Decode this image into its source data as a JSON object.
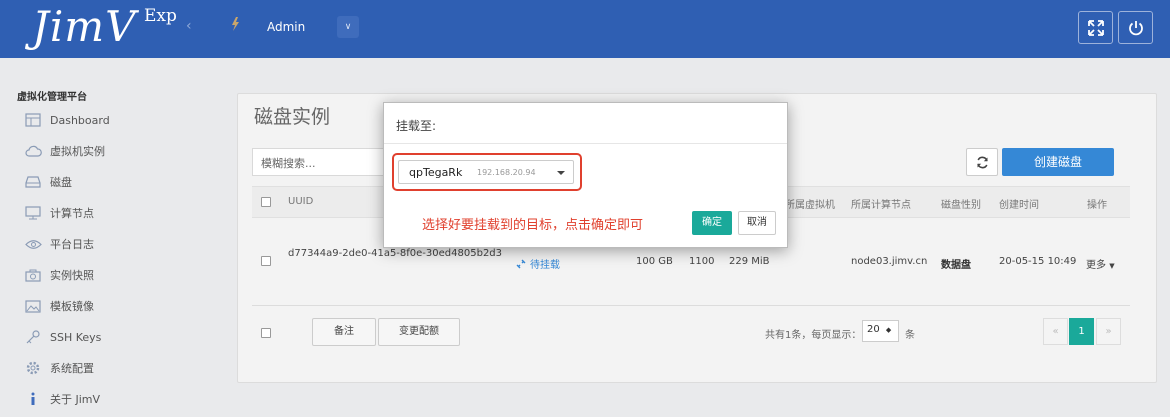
{
  "header": {
    "logo": "JimV",
    "logo_sup": "Exp",
    "collapse_glyph": "‹",
    "user_name": "Admin",
    "user_dropdown_glyph": "∨"
  },
  "sidebar": {
    "title": "虚拟化管理平台",
    "items": [
      {
        "label": "Dashboard",
        "icon": "dashboard-icon"
      },
      {
        "label": "虚拟机实例",
        "icon": "cloud-icon"
      },
      {
        "label": "磁盘",
        "icon": "disk-icon"
      },
      {
        "label": "计算节点",
        "icon": "monitor-icon"
      },
      {
        "label": "平台日志",
        "icon": "eye-icon"
      },
      {
        "label": "实例快照",
        "icon": "camera-icon"
      },
      {
        "label": "模板镜像",
        "icon": "image-icon"
      },
      {
        "label": "SSH Keys",
        "icon": "key-icon"
      },
      {
        "label": "系统配置",
        "icon": "gear-icon"
      },
      {
        "label": "关于 JimV",
        "icon": "info-icon"
      }
    ]
  },
  "main": {
    "title": "磁盘实例",
    "search_placeholder": "模糊搜索...",
    "create_label": "创建磁盘",
    "columns": {
      "uuid": "UUID",
      "vm": "所属虚拟机",
      "node": "所属计算节点",
      "disk_type": "磁盘性别",
      "created": "创建时间",
      "actions": "操作"
    },
    "row": {
      "uuid": "d77344a9-2de0-41a5-8f0e-30ed4805b2d3",
      "status": "待挂载",
      "size": "100 GB",
      "iops": "1100",
      "bandwidth": "229 MiB",
      "node": "node03.jimv.cn",
      "disk_type": "数据盘",
      "created": "20-05-15 10:49",
      "more": "更多"
    },
    "footer": {
      "note_btn": "备注",
      "config_btn": "变更配额",
      "summary": "共有1条，每页显示：",
      "page_size": "20",
      "unit": "条",
      "prev": "«",
      "page": "1",
      "next": "»"
    }
  },
  "modal": {
    "title": "挂载至:",
    "selected_name": "qpTegaRk",
    "selected_ip": "192.168.20.94",
    "hint": "选择好要挂载到的目标，点击确定即可",
    "ok": "确定",
    "cancel": "取消"
  },
  "colors": {
    "topbar": "#2f5fb3",
    "primary": "#3588d6",
    "teal": "#1aa99a",
    "highlight_red": "#e0402e"
  }
}
